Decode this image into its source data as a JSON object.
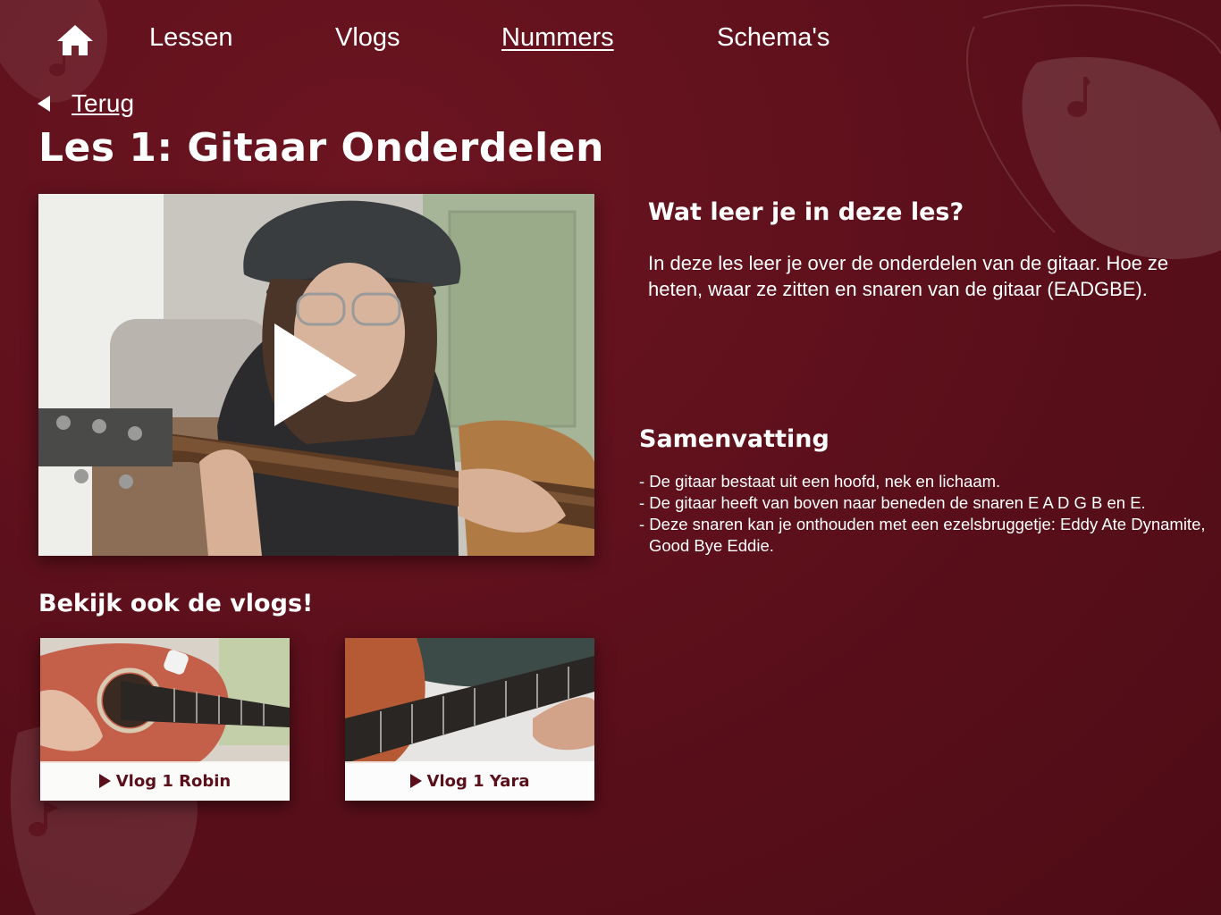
{
  "nav": {
    "home_icon": "home-icon",
    "items": [
      {
        "label": "Lessen",
        "active": false
      },
      {
        "label": "Vlogs",
        "active": false
      },
      {
        "label": "Nummers",
        "active": true
      },
      {
        "label": "Schema's",
        "active": false
      }
    ]
  },
  "back": {
    "label": "Terug",
    "icon": "caret-left-icon"
  },
  "page_title": "Les 1: Gitaar Onderdelen",
  "video": {
    "icon": "play-icon"
  },
  "learn": {
    "heading": "Wat leer je in deze les?",
    "text": "In deze les leer je over de onderdelen van de gitaar. Hoe ze heten, waar ze zitten en snaren van de gitaar (EADGBE)."
  },
  "summary": {
    "heading": "Samenvatting",
    "items": [
      "- De gitaar bestaat uit een hoofd, nek en lichaam.",
      "- De gitaar heeft van boven naar beneden de snaren E A D G B en E.",
      "- Deze snaren kan je onthouden met een ezelsbruggetje: Eddy Ate Dynamite, Good Bye Eddie."
    ]
  },
  "vlogs": {
    "heading": "Bekijk ook de vlogs!",
    "items": [
      {
        "label": "Vlog 1 Robin"
      },
      {
        "label": "Vlog 1 Yara"
      }
    ]
  },
  "colors": {
    "background": "#5a0f1a",
    "accent": "#6c1521",
    "text": "#ffffff"
  }
}
